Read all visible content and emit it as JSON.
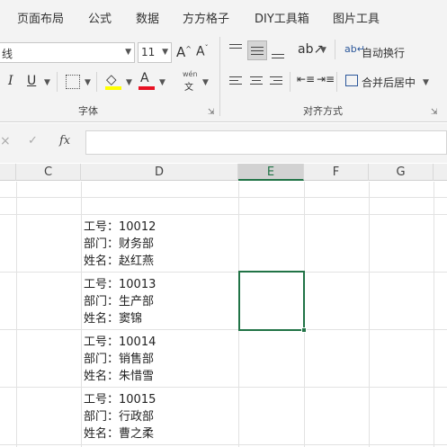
{
  "menu": {
    "tabs": [
      "页面布局",
      "公式",
      "数据",
      "方方格子",
      "DIY工具箱",
      "图片工具"
    ]
  },
  "font_group": {
    "font_name": "线",
    "font_size": "11",
    "grow_icon": "A^",
    "shrink_icon": "A˅",
    "italic": "I",
    "underline": "U",
    "font_color_letter": "A",
    "phonetic_top": "wén",
    "phonetic_bottom": "文",
    "label": "字体",
    "highlight_color": "#FFFF00",
    "font_color": "#E81123"
  },
  "align_group": {
    "wrap_text": "自动换行",
    "merge_center": "合并后居中",
    "label": "对齐方式"
  },
  "formula_bar": {
    "fx_label": "fx",
    "value": ""
  },
  "columns": [
    "C",
    "D",
    "E",
    "F",
    "G"
  ],
  "active_column": "E",
  "records": [
    {
      "id_line": "工号：10012",
      "dept_line": "部门：财务部",
      "name_line": "姓名：赵红燕"
    },
    {
      "id_line": "工号：10013",
      "dept_line": "部门：生产部",
      "name_line": "姓名：窦锦"
    },
    {
      "id_line": "工号：10014",
      "dept_line": "部门：销售部",
      "name_line": "姓名：朱惜雪"
    },
    {
      "id_line": "工号：10015",
      "dept_line": "部门：行政部",
      "name_line": "姓名：曹之柔"
    }
  ],
  "colors": {
    "accent": "#217346"
  }
}
